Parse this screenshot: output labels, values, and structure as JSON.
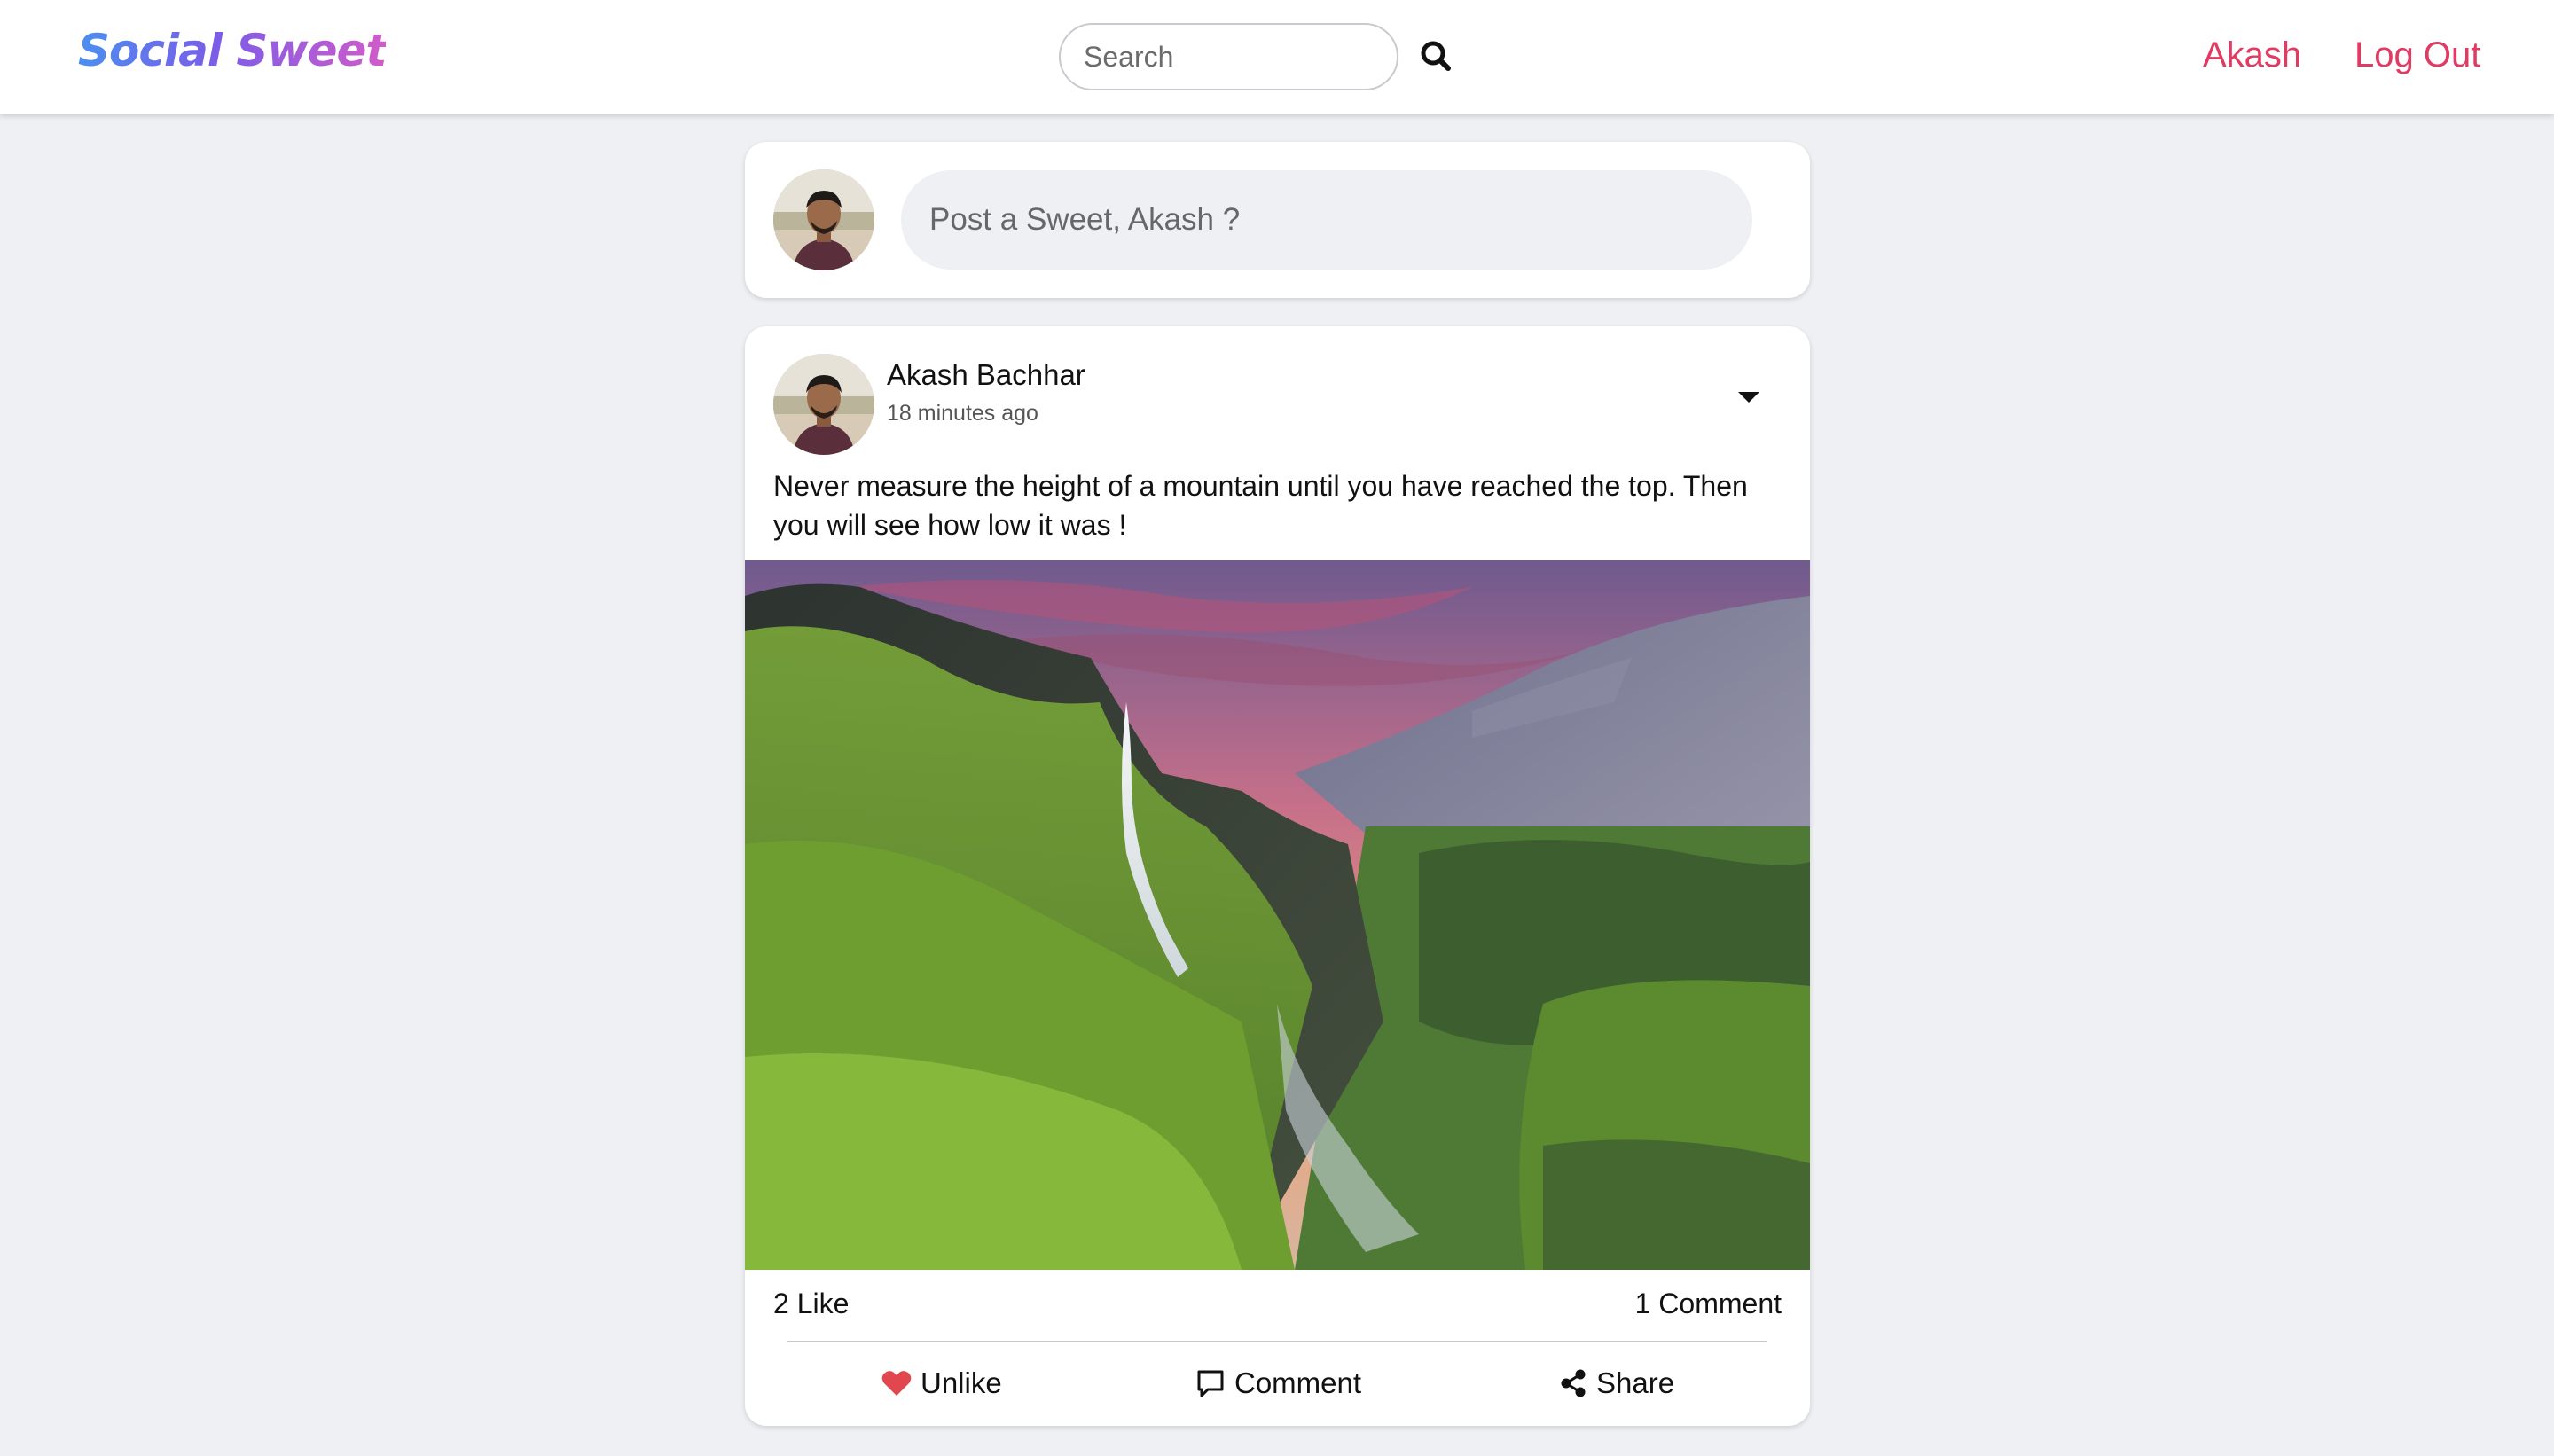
{
  "navbar": {
    "logo": "Social Sweet",
    "search_placeholder": "Search",
    "user_link": "Akash",
    "logout_link": "Log Out"
  },
  "composer": {
    "placeholder": "Post a Sweet, Akash ?"
  },
  "post": {
    "author": "Akash Bachhar",
    "time": "18 minutes ago",
    "text": "Never measure the height of a mountain until you have reached the top. Then you will see how low it was !",
    "likes": "2 Like",
    "comments": "1 Comment",
    "actions": {
      "unlike": "Unlike",
      "comment": "Comment",
      "share": "Share"
    }
  },
  "icons": {
    "search": "search-icon",
    "caret": "caret-down-icon",
    "heart": "heart-icon",
    "comment": "comment-icon",
    "share": "share-icon"
  },
  "colors": {
    "accent": "#e03b62",
    "heart": "#e0474f",
    "background": "#eff0f4"
  }
}
